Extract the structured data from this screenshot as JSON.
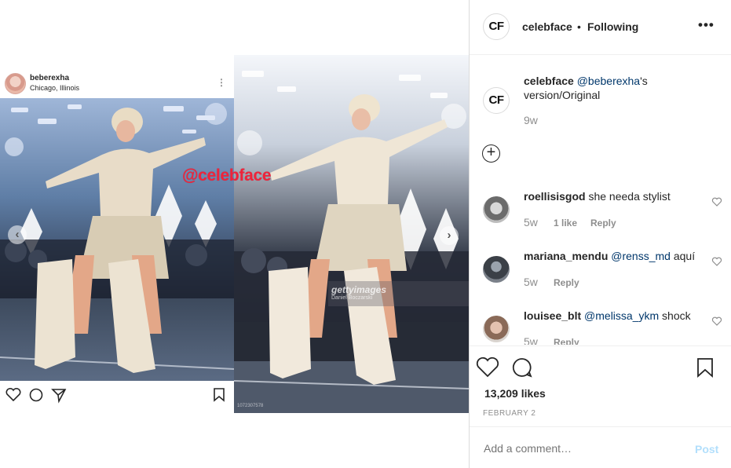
{
  "media": {
    "embedded_post": {
      "username": "beberexha",
      "location": "Chicago, Illinois",
      "menu_icon": "kebab-icon",
      "action_icons": [
        "heart-icon",
        "comment-icon",
        "share-icon",
        "bookmark-icon"
      ]
    },
    "watermark": "@celebface",
    "getty": {
      "brand": "gettyimages",
      "credit": "Daniel Boczarski",
      "image_id": "1072307578"
    },
    "nav": {
      "prev_icon": "chevron-left-icon",
      "next_icon": "chevron-right-icon"
    }
  },
  "panel": {
    "header": {
      "avatar_text": "CF",
      "username": "celebface",
      "separator": "•",
      "follow_status": "Following",
      "more_label": "•••"
    },
    "caption": {
      "avatar_text": "CF",
      "username": "celebface",
      "mention": "@beberexha",
      "text_after_mention": "'s",
      "text_line2": "version/Original",
      "time": "9w"
    },
    "add_icon": "+",
    "comments": [
      {
        "username": "roellisisgod",
        "mention": "",
        "text": "she needa stylist",
        "time": "5w",
        "likes": "1 like",
        "reply": "Reply"
      },
      {
        "username": "mariana_mendu",
        "mention": "@renss_md",
        "text": "aquí",
        "time": "5w",
        "likes": "",
        "reply": "Reply"
      },
      {
        "username": "louisee_blt",
        "mention": "@melissa_ykm",
        "text": "shock",
        "time": "5w",
        "likes": "",
        "reply": "Reply"
      }
    ],
    "actions": {
      "like_icon": "heart-icon",
      "comment_icon": "comment-icon",
      "save_icon": "bookmark-icon",
      "likes_count": "13,209 likes",
      "date": "FEBRUARY 2"
    },
    "add_comment": {
      "placeholder": "Add a comment…",
      "post_label": "Post"
    }
  },
  "colors": {
    "mention": "#00376b",
    "watermark": "#f0233a",
    "post_disabled": "#b2dffc",
    "secondary_text": "#8e8e8e",
    "border": "#dbdbdb"
  }
}
